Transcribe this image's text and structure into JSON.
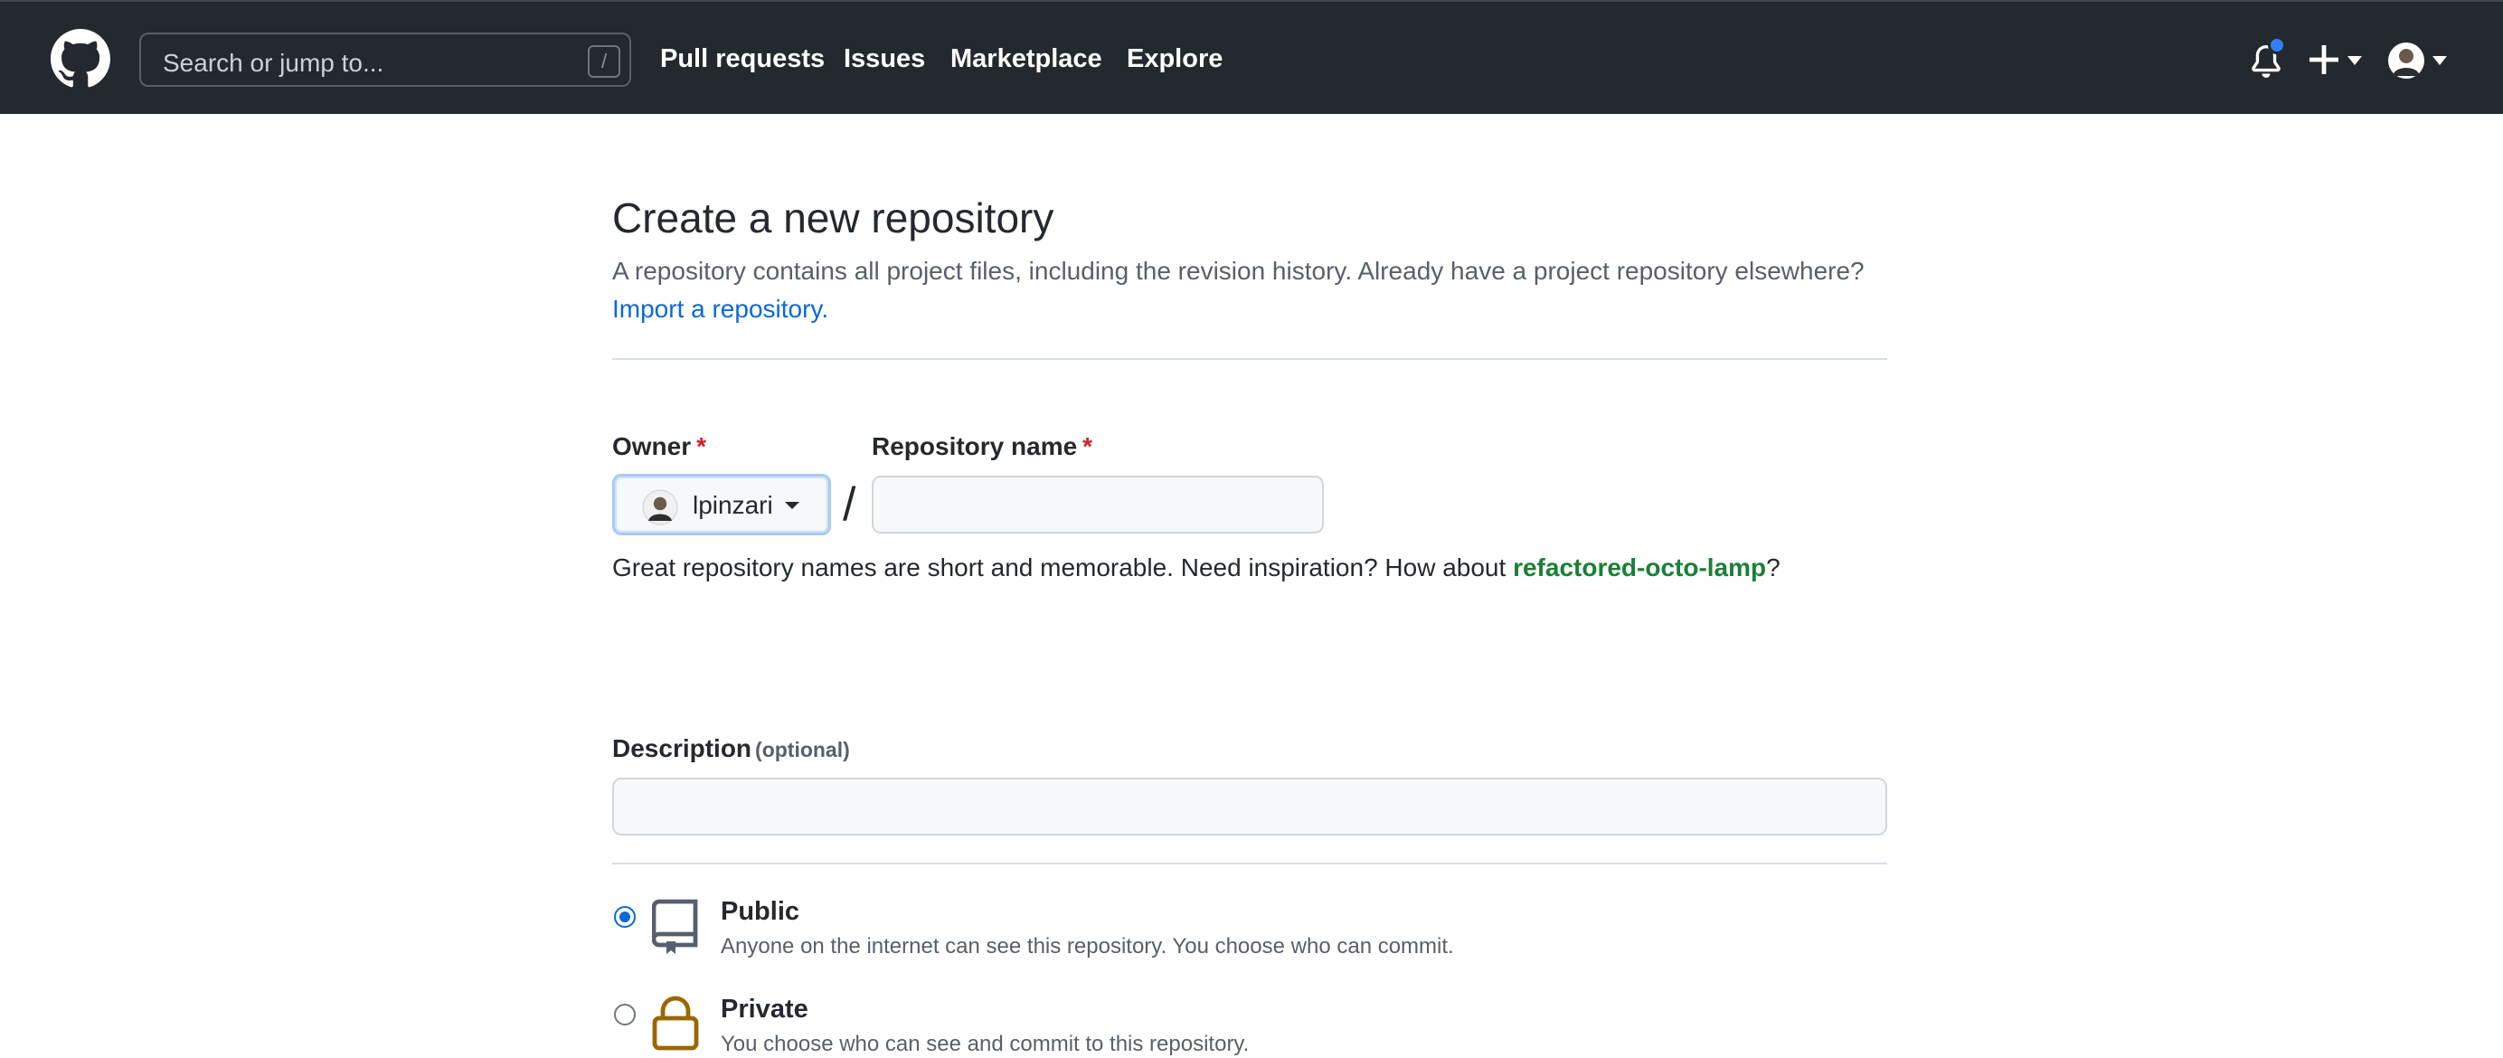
{
  "header": {
    "search_placeholder": "Search or jump to...",
    "search_shortcut": "/",
    "nav": {
      "pull_requests": "Pull requests",
      "issues": "Issues",
      "marketplace": "Marketplace",
      "explore": "Explore"
    },
    "icons": [
      "github-logo",
      "bell-icon",
      "plus-icon",
      "avatar"
    ],
    "notification_dot_color": "#2f81f7"
  },
  "page": {
    "title": "Create a new repository",
    "subtitle": "A repository contains all project files, including the revision history. Already have a project repository elsewhere?",
    "import_link": "Import a repository."
  },
  "form": {
    "owner_label": "Owner",
    "required_mark": "*",
    "owner_value": "lpinzari",
    "separator": "/",
    "repo_name_label": "Repository name",
    "repo_name_value": "",
    "hint_prefix": "Great repository names are short and memorable. Need inspiration? How about ",
    "hint_suggestion": "refactored-octo-lamp",
    "hint_suffix": "?",
    "description_label": "Description",
    "description_optional": "(optional)",
    "description_value": ""
  },
  "visibility": {
    "selected": "public",
    "public_title": "Public",
    "public_desc": "Anyone on the internet can see this repository. You choose who can commit.",
    "private_title": "Private",
    "private_desc": "You choose who can see and commit to this repository."
  },
  "colors": {
    "header_bg": "#24292f",
    "link": "#0969da",
    "suggestion": "#1a7f37",
    "required": "#cf222e",
    "lock_icon": "#9a6700"
  }
}
